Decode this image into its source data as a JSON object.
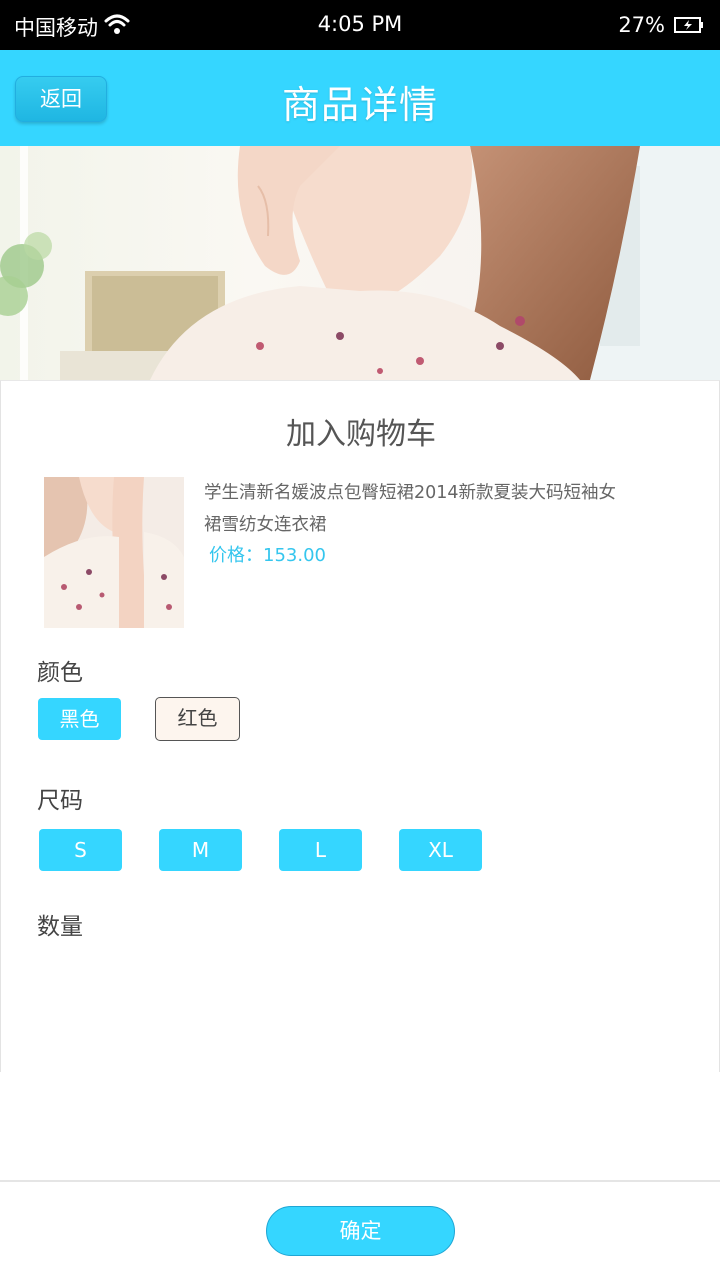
{
  "status_bar": {
    "carrier": "中国移动",
    "time": "4:05 PM",
    "battery": "27%",
    "wifi_icon": "wifi-icon",
    "battery_icon": "battery-charging-icon"
  },
  "header": {
    "back_label": "返回",
    "title": "商品详情"
  },
  "cart_panel": {
    "title": "加入购物车",
    "product_name": "学生清新名媛波点包臀短裙2014新款夏装大码短袖女裙雪纺女连衣裙",
    "price": "价格：153.00",
    "color_label": "颜色",
    "colors": [
      "黑色",
      "红色"
    ],
    "size_label": "尺码",
    "sizes": [
      "S",
      "M",
      "L",
      "XL"
    ],
    "quantity_label": "数量"
  },
  "footer": {
    "confirm_label": "确定"
  },
  "theme": {
    "accent": "#35d6ff",
    "price_color": "#35c6ee"
  }
}
